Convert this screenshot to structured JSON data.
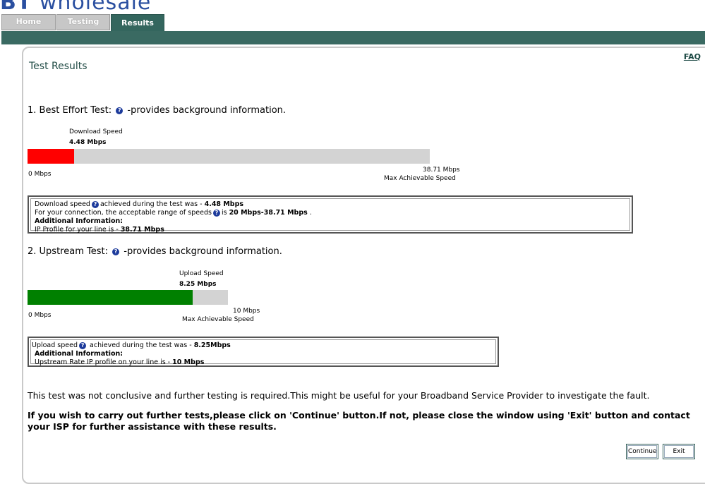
{
  "logo": {
    "brand": "BT",
    "text": "wholesale"
  },
  "tabs": [
    {
      "label": "Home",
      "active": false
    },
    {
      "label": "Testing",
      "active": false
    },
    {
      "label": "Results",
      "active": true
    }
  ],
  "faq": "FAQ",
  "page_title": "Test Results",
  "best_effort": {
    "heading_prefix": "1. Best Effort Test:",
    "heading_suffix": "-provides background information.",
    "speed_label": "Download Speed",
    "speed_value": "4.48 Mbps",
    "min_label": "0 Mbps",
    "max_value": "38.71 Mbps",
    "max_label": "Max Achievable Speed",
    "fill_fraction": 0.1157,
    "fill_color": "#ff0000",
    "info": {
      "line1_a": "Download speed",
      "line1_b": "achieved during the test was -",
      "line1_val": "4.48 Mbps",
      "line2_a": "For your connection, the acceptable range of speeds",
      "line2_b": "is",
      "line2_val": "20 Mbps-38.71 Mbps",
      "line2_end": ".",
      "line3": "Additional Information:",
      "line4_a": "IP Profile for your line is -",
      "line4_val": "38.71 Mbps"
    }
  },
  "upstream": {
    "heading_prefix": "2. Upstream Test:",
    "heading_suffix": "-provides background information.",
    "speed_label": "Upload Speed",
    "speed_value": "8.25 Mbps",
    "min_label": "0 Mbps",
    "max_value": "10 Mbps",
    "max_label": "Max Achievable Speed",
    "fill_fraction": 0.825,
    "fill_color": "#008000",
    "info": {
      "line1_a": "Upload speed",
      "line1_b": "achieved during the test was -",
      "line1_val": "8.25Mbps",
      "line2": "Additional Information:",
      "line3_a": "Upstream Rate IP profile on your line is -",
      "line3_val": "10 Mbps"
    }
  },
  "conclusion": "This test was not conclusive and further testing is required.This might be useful for your Broadband Service Provider to investigate the fault.",
  "instruction": "If you wish to carry out further tests,please click on 'Continue' button.If not, please close the window using 'Exit' button and contact your ISP for further assistance with these results.",
  "buttons": {
    "continue": "Continue",
    "exit": "Exit"
  },
  "help_icon_glyph": "?",
  "colors": {
    "teal": "#3a6a62",
    "logo_blue": "#2a4fa0",
    "help_icon": "#1c3a9b"
  }
}
